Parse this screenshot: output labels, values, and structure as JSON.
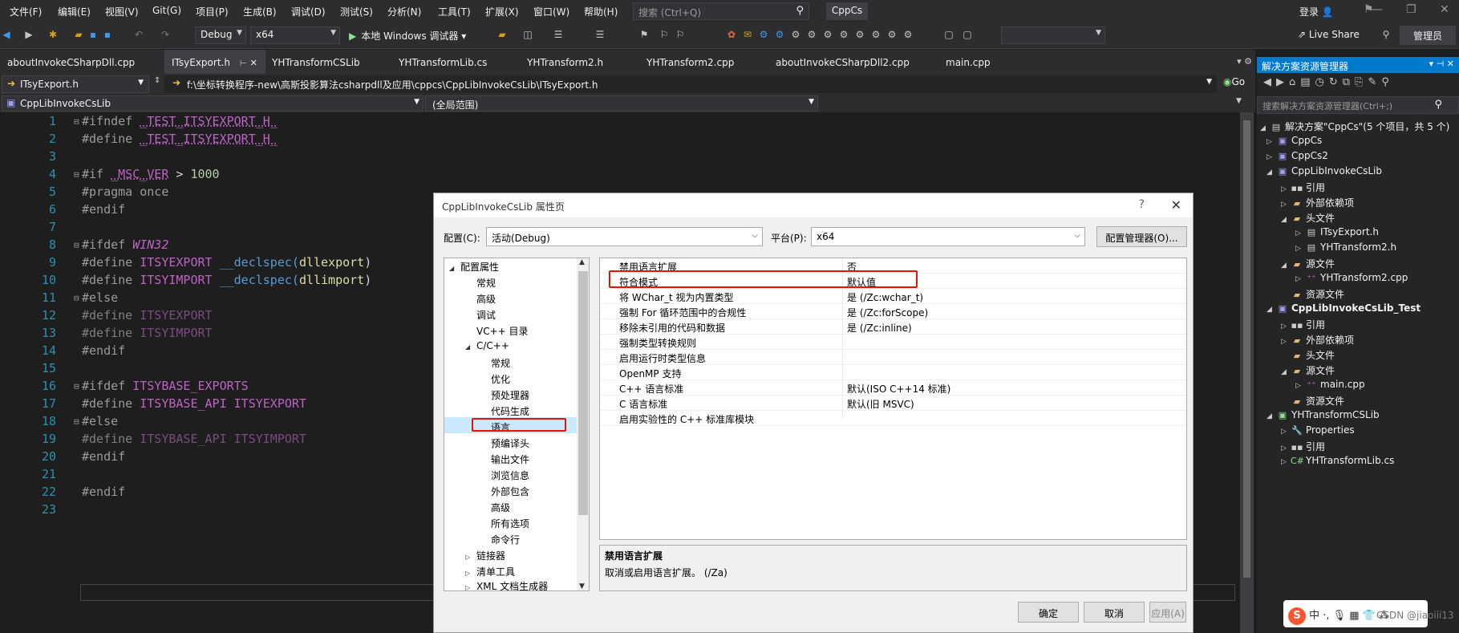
{
  "menubar": {
    "items": [
      "文件(F)",
      "编辑(E)",
      "视图(V)",
      "Git(G)",
      "项目(P)",
      "生成(B)",
      "调试(D)",
      "测试(S)",
      "分析(N)",
      "工具(T)",
      "扩展(X)",
      "窗口(W)",
      "帮助(H)"
    ],
    "search_placeholder": "搜索 (Ctrl+Q)",
    "solution_name": "CppCs",
    "login": "登录"
  },
  "toolbar": {
    "config": "Debug",
    "platform": "x64",
    "run_label": "本地 Windows 调试器"
  },
  "titlebar_right": {
    "live_share": "Live Share",
    "admin": "管理员"
  },
  "tabs": [
    {
      "label": "aboutInvokeCSharpDll.cpp",
      "active": false
    },
    {
      "label": "ITsyExport.h",
      "active": true
    },
    {
      "label": "YHTransformCSLib",
      "active": false
    },
    {
      "label": "YHTransformLib.cs",
      "active": false
    },
    {
      "label": "YHTransform2.h",
      "active": false
    },
    {
      "label": "YHTransform2.cpp",
      "active": false
    },
    {
      "label": "aboutInvokeCSharpDll2.cpp",
      "active": false
    },
    {
      "label": "main.cpp",
      "active": false
    }
  ],
  "navbar": {
    "file": "ITsyExport.h",
    "path": "f:\\坐标转换程序-new\\高斯投影算法csharpdll及应用\\cppcs\\CppLibInvokeCsLib\\ITsyExport.h"
  },
  "scopebar": {
    "project": "CppLibInvokeCsLib",
    "scope": "(全局范围)"
  },
  "editor": {
    "line_numbers": [
      "1",
      "2",
      "3",
      "4",
      "5",
      "6",
      "7",
      "8",
      "9",
      "10",
      "11",
      "12",
      "13",
      "14",
      "15",
      "16",
      "17",
      "18",
      "19",
      "20",
      "21",
      "22",
      "23"
    ],
    "l1a": "#ifndef ",
    "l1b": "_TEST_ITSYEXPORT_H_",
    "l2a": "#define ",
    "l2b": "_TEST_ITSYEXPORT_H_",
    "l4a": "#if ",
    "l4b": "_MSC_VER",
    "l4c": " > ",
    "l4d": "1000",
    "l5": "#pragma once",
    "l6": "#endif",
    "l8a": "#ifdef ",
    "l8b": "WIN32",
    "l9a": "#define ",
    "l9b": "ITSYEXPORT",
    "l9c": " __declspec(",
    "l9d": "dllexport",
    "l9e": ")",
    "l10a": "#define ",
    "l10b": "ITSYIMPORT",
    "l10c": " __declspec(",
    "l10d": "dllimport",
    "l10e": ")",
    "l11": "#else",
    "l12a": "#define ",
    "l12b": "ITSYEXPORT",
    "l13a": "#define ",
    "l13b": "ITSYIMPORT",
    "l14": "#endif",
    "l16a": "#ifdef ",
    "l16b": "ITSYBASE_EXPORTS",
    "l17a": "#define ",
    "l17b": "ITSYBASE_API",
    "l17c": " ",
    "l17d": "ITSYEXPORT",
    "l18": "#else",
    "l19a": "#define ",
    "l19b": "ITSYBASE_API ITSYIMPORT",
    "l20": "#endif",
    "l22": "#endif"
  },
  "solution_explorer": {
    "title": "解决方案资源管理器",
    "search_placeholder": "搜索解决方案资源管理器(Ctrl+;)",
    "items": [
      {
        "label": "解决方案\"CppCs\"(5 个项目，共 5 个)",
        "icon": "solution-icon",
        "bold": false
      },
      {
        "label": "CppCs",
        "icon": "cpp-project-icon",
        "bold": false
      },
      {
        "label": "CppCs2",
        "icon": "cpp-project-icon",
        "bold": false
      },
      {
        "label": "CppLibInvokeCsLib",
        "icon": "cpp-project-icon",
        "bold": false
      },
      {
        "label": "引用",
        "icon": "references-icon",
        "bold": false
      },
      {
        "label": "外部依赖项",
        "icon": "folder-icon",
        "bold": false
      },
      {
        "label": "头文件",
        "icon": "folder-icon",
        "bold": false
      },
      {
        "label": "ITsyExport.h",
        "icon": "header-file-icon",
        "bold": false
      },
      {
        "label": "YHTransform2.h",
        "icon": "header-file-icon",
        "bold": false
      },
      {
        "label": "源文件",
        "icon": "folder-icon",
        "bold": false
      },
      {
        "label": "YHTransform2.cpp",
        "icon": "cpp-file-icon",
        "bold": false
      },
      {
        "label": "资源文件",
        "icon": "folder-icon",
        "bold": false
      },
      {
        "label": "CppLibInvokeCsLib_Test",
        "icon": "cpp-project-icon",
        "bold": true
      },
      {
        "label": "引用",
        "icon": "references-icon",
        "bold": false
      },
      {
        "label": "外部依赖项",
        "icon": "folder-icon",
        "bold": false
      },
      {
        "label": "头文件",
        "icon": "folder-icon",
        "bold": false
      },
      {
        "label": "源文件",
        "icon": "folder-icon",
        "bold": false
      },
      {
        "label": "main.cpp",
        "icon": "cpp-file-icon",
        "bold": false
      },
      {
        "label": "资源文件",
        "icon": "folder-icon",
        "bold": false
      },
      {
        "label": "YHTransformCSLib",
        "icon": "cs-project-icon",
        "bold": false
      },
      {
        "label": "Properties",
        "icon": "wrench-icon",
        "bold": false
      },
      {
        "label": "引用",
        "icon": "references-icon",
        "bold": false
      },
      {
        "label": "YHTransformLib.cs",
        "icon": "cs-file-icon",
        "bold": false
      }
    ]
  },
  "dialog": {
    "title": "CppLibInvokeCsLib 属性页",
    "config_label": "配置(C):",
    "config_value": "活动(Debug)",
    "platform_label": "平台(P):",
    "platform_value": "x64",
    "config_manager": "配置管理器(O)...",
    "tree": [
      {
        "label": "配置属性",
        "tri": "◢"
      },
      {
        "label": "常规",
        "tri": ""
      },
      {
        "label": "高级",
        "tri": ""
      },
      {
        "label": "调试",
        "tri": ""
      },
      {
        "label": "VC++ 目录",
        "tri": ""
      },
      {
        "label": "C/C++",
        "tri": "◢"
      },
      {
        "label": "常规",
        "tri": ""
      },
      {
        "label": "优化",
        "tri": ""
      },
      {
        "label": "预处理器",
        "tri": ""
      },
      {
        "label": "代码生成",
        "tri": ""
      },
      {
        "label": "语言",
        "tri": ""
      },
      {
        "label": "预编译头",
        "tri": ""
      },
      {
        "label": "输出文件",
        "tri": ""
      },
      {
        "label": "浏览信息",
        "tri": ""
      },
      {
        "label": "外部包含",
        "tri": ""
      },
      {
        "label": "高级",
        "tri": ""
      },
      {
        "label": "所有选项",
        "tri": ""
      },
      {
        "label": "命令行",
        "tri": ""
      },
      {
        "label": "链接器",
        "tri": "▷"
      },
      {
        "label": "清单工具",
        "tri": "▷"
      },
      {
        "label": "XML 文档生成器",
        "tri": "▷"
      }
    ],
    "properties": [
      {
        "name": "禁用语言扩展",
        "value": "否"
      },
      {
        "name": "符合模式",
        "value": "默认值"
      },
      {
        "name": "将 WChar_t 视为内置类型",
        "value": "是 (/Zc:wchar_t)"
      },
      {
        "name": "强制 For 循环范围中的合规性",
        "value": "是 (/Zc:forScope)"
      },
      {
        "name": "移除未引用的代码和数据",
        "value": "是 (/Zc:inline)"
      },
      {
        "name": "强制类型转换规则",
        "value": ""
      },
      {
        "name": "启用运行时类型信息",
        "value": ""
      },
      {
        "name": "OpenMP 支持",
        "value": ""
      },
      {
        "name": "C++ 语言标准",
        "value": "默认(ISO C++14 标准)"
      },
      {
        "name": "C 语言标准",
        "value": "默认(旧 MSVC)"
      },
      {
        "name": "启用实验性的 C++ 标准库模块",
        "value": ""
      }
    ],
    "desc_title": "禁用语言扩展",
    "desc_text": "取消或启用语言扩展。     (/Za)",
    "ok": "确定",
    "cancel": "取消",
    "apply": "应用(A)"
  },
  "overlay": {
    "csdn_text": "中 ·, 🎙 ▦ 👕 ⁂",
    "watermark": "CSDN @jiaoiii13"
  }
}
